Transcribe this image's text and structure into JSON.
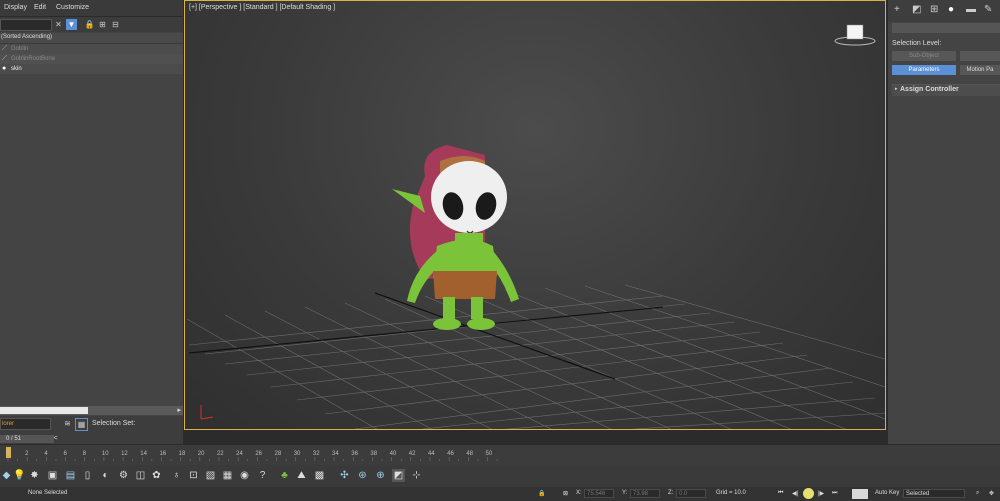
{
  "menu": {
    "display": "Display",
    "edit": "Edit",
    "customize": "Customize"
  },
  "explorer": {
    "sort_header": "(Sorted Ascending)",
    "items": [
      {
        "label": "Goblin",
        "color": "#8a8a8a"
      },
      {
        "label": "GoblinRootBone",
        "color": "#8a8a8a"
      },
      {
        "label": "skin",
        "color": "#f0f0f0"
      }
    ],
    "explorer_dropdown": "lorer",
    "frame_counter": "0 / 51",
    "selection_set_label": "Selection Set:"
  },
  "viewport": {
    "label": "[+] [Perspective ] [Standard ] [Default Shading ]"
  },
  "command_panel": {
    "selection_level": "Selection Level:",
    "sub_object": "Sub-Object",
    "parameters": "Parameters",
    "motion_paths": "Motion Pa",
    "assign_controller": "Assign Controller"
  },
  "timeline": {
    "ticks": [
      "0",
      "2",
      "4",
      "6",
      "8",
      "10",
      "12",
      "14",
      "16",
      "18",
      "20",
      "22",
      "24",
      "26",
      "28",
      "30",
      "32",
      "34",
      "36",
      "38",
      "40",
      "42",
      "44",
      "46",
      "48",
      "50"
    ]
  },
  "status": {
    "selection": "None Selected",
    "x_label": "X:",
    "x_value": "75.546",
    "y_label": "Y:",
    "y_value": "73.98",
    "z_label": "Z:",
    "z_value": "0.0",
    "grid": "Grid = 10.0",
    "auto_key": "Auto Key",
    "key_mode": "Selected"
  },
  "colors": {
    "accent_blue": "#5b8fd6",
    "viewport_border": "#d9b34a",
    "goblin_green": "#7bc43a"
  }
}
